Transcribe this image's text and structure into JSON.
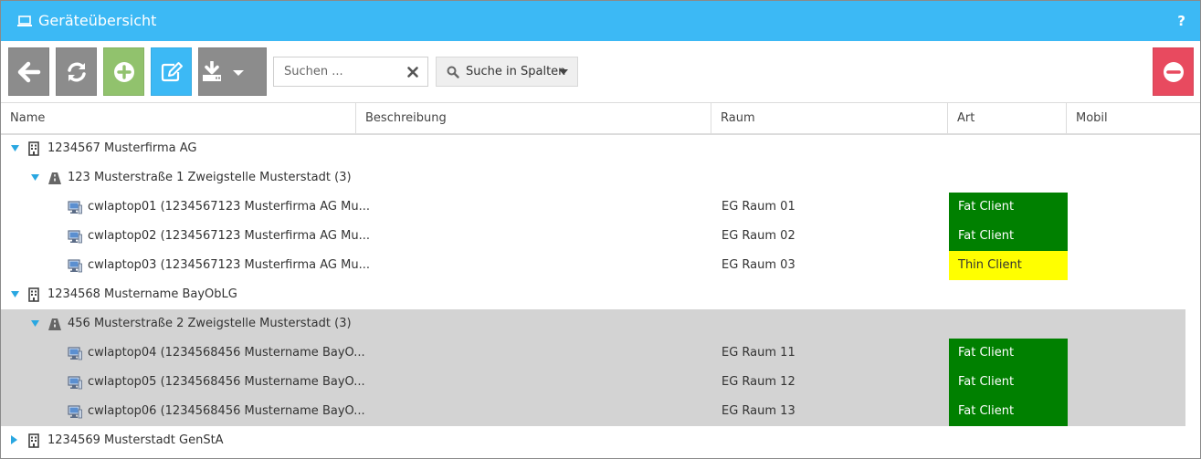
{
  "window": {
    "title": "Geräteübersicht",
    "help_label": "?",
    "accent_color": "#3cb9f5"
  },
  "toolbar": {
    "buttons": [
      {
        "name": "back-button",
        "icon": "arrow-left-icon",
        "color": "#8c8c8c"
      },
      {
        "name": "refresh-button",
        "icon": "refresh-icon",
        "color": "#8c8c8c"
      },
      {
        "name": "add-button",
        "icon": "plus-circle-icon",
        "color": "#91c26d"
      },
      {
        "name": "edit-button",
        "icon": "edit-icon",
        "color": "#3cb9f5"
      },
      {
        "name": "export-button",
        "icon": "download-icon",
        "color": "#8c8c8c"
      },
      {
        "name": "delete-button",
        "icon": "minus-circle-icon",
        "color": "#e84a5f"
      }
    ],
    "search": {
      "placeholder": "Suchen ...",
      "value": ""
    },
    "column_search_label": "Suche in Spalten"
  },
  "columns": {
    "name": "Name",
    "description": "Beschreibung",
    "room": "Raum",
    "type": "Art",
    "mobile": "Mobil"
  },
  "type_colors": {
    "Fat Client": {
      "bg": "#008000",
      "fg": "#ffffff"
    },
    "Thin Client": {
      "bg": "#ffff00",
      "fg": "#333333"
    }
  },
  "rows": [
    {
      "level": 0,
      "kind": "org",
      "icon": "building-icon",
      "expanded": true,
      "label": "1234567 Musterfirma AG",
      "room": "",
      "type": "",
      "selected": false
    },
    {
      "level": 1,
      "kind": "location",
      "icon": "road-icon",
      "expanded": true,
      "label": "123 Musterstraße 1 Zweigstelle Musterstadt (3)",
      "room": "",
      "type": "",
      "selected": false
    },
    {
      "level": 2,
      "kind": "device",
      "icon": "computer-icon",
      "label": "cwlaptop01 (1234567123 Musterfirma AG Mu...",
      "room": "EG Raum 01",
      "type": "Fat Client",
      "selected": false
    },
    {
      "level": 2,
      "kind": "device",
      "icon": "computer-icon",
      "label": "cwlaptop02 (1234567123 Musterfirma AG Mu...",
      "room": "EG Raum 02",
      "type": "Fat Client",
      "selected": false
    },
    {
      "level": 2,
      "kind": "device",
      "icon": "computer-icon",
      "label": "cwlaptop03 (1234567123 Musterfirma AG Mu...",
      "room": "EG Raum 03",
      "type": "Thin Client",
      "selected": false
    },
    {
      "level": 0,
      "kind": "org",
      "icon": "building-icon",
      "expanded": true,
      "label": "1234568 Mustername BayObLG",
      "room": "",
      "type": "",
      "selected": false
    },
    {
      "level": 1,
      "kind": "location",
      "icon": "road-icon",
      "expanded": true,
      "label": "456 Musterstraße 2 Zweigstelle Musterstadt (3)",
      "room": "",
      "type": "",
      "selected": true
    },
    {
      "level": 2,
      "kind": "device",
      "icon": "computer-icon",
      "label": "cwlaptop04 (1234568456 Mustername BayO...",
      "room": "EG Raum 11",
      "type": "Fat Client",
      "selected": true
    },
    {
      "level": 2,
      "kind": "device",
      "icon": "computer-icon",
      "label": "cwlaptop05 (1234568456 Mustername BayO...",
      "room": "EG Raum 12",
      "type": "Fat Client",
      "selected": true
    },
    {
      "level": 2,
      "kind": "device",
      "icon": "computer-icon",
      "label": "cwlaptop06 (1234568456 Mustername BayO...",
      "room": "EG Raum 13",
      "type": "Fat Client",
      "selected": true
    },
    {
      "level": 0,
      "kind": "org",
      "icon": "building-icon",
      "expanded": false,
      "label": "1234569 Musterstadt GenStA",
      "room": "",
      "type": "",
      "selected": false
    }
  ]
}
